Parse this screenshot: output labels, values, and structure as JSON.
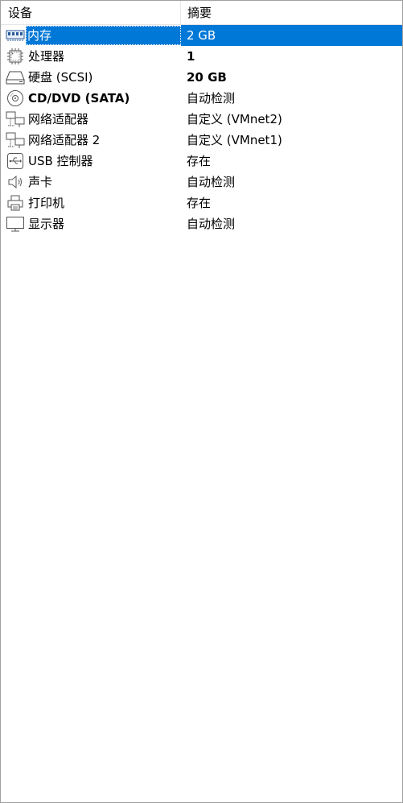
{
  "header": {
    "device": "设备",
    "summary": "摘要"
  },
  "devices": [
    {
      "name": "内存",
      "summary": "2 GB",
      "icon": "memory-icon",
      "bold": true,
      "selected": true
    },
    {
      "name": "处理器",
      "summary": "1",
      "icon": "processor-icon",
      "bold": true,
      "selected": false
    },
    {
      "name": "硬盘 (SCSI)",
      "summary": "20 GB",
      "icon": "hard-disk-icon",
      "bold": true,
      "selected": false
    },
    {
      "name": "CD/DVD (SATA)",
      "summary": "自动检测",
      "icon": "cd-dvd-icon",
      "bold": true,
      "selected": false
    },
    {
      "name": "网络适配器",
      "summary": "自定义 (VMnet2)",
      "icon": "network-adapter-icon",
      "bold": false,
      "selected": false
    },
    {
      "name": "网络适配器 2",
      "summary": "自定义 (VMnet1)",
      "icon": "network-adapter-icon",
      "bold": false,
      "selected": false
    },
    {
      "name": "USB 控制器",
      "summary": "存在",
      "icon": "usb-icon",
      "bold": false,
      "selected": false
    },
    {
      "name": "声卡",
      "summary": "自动检测",
      "icon": "sound-card-icon",
      "bold": false,
      "selected": false
    },
    {
      "name": "打印机",
      "summary": "存在",
      "icon": "printer-icon",
      "bold": false,
      "selected": false
    },
    {
      "name": "显示器",
      "summary": "自动检测",
      "icon": "display-icon",
      "bold": false,
      "selected": false
    }
  ],
  "colors": {
    "selection": "#0078d7",
    "border": "#a0a0a0",
    "grid": "#e6e6e6"
  }
}
